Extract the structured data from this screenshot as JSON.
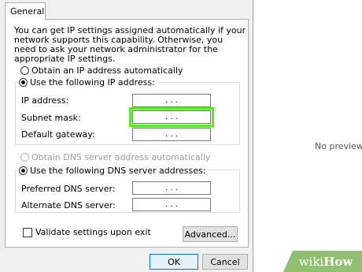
{
  "dialog": {
    "tab_label": "General",
    "intro_text": "You can get IP settings assigned automatically if your network supports this capability. Otherwise, you need to ask your network administrator for the appropriate IP settings.",
    "ip": {
      "auto_label": "Obtain an IP address automatically",
      "manual_label": "Use the following IP address:",
      "fields": [
        {
          "label": "IP address:",
          "value": ".   .   ."
        },
        {
          "label": "Subnet mask:",
          "value": ".   .   ."
        },
        {
          "label": "Default gateway:",
          "value": ".   .   ."
        }
      ]
    },
    "dns": {
      "auto_label": "Obtain DNS server address automatically",
      "manual_label": "Use the following DNS server addresses:",
      "fields": [
        {
          "label": "Preferred DNS server:",
          "value": ".   .   ."
        },
        {
          "label": "Alternate DNS server:",
          "value": ".   .   ."
        }
      ]
    },
    "validate_label": "Validate settings upon exit",
    "advanced_label": "Advanced...",
    "ok_label": "OK",
    "cancel_label": "Cancel"
  },
  "preview": {
    "text": "No preview av"
  },
  "watermark": {
    "wiki": "wiki",
    "how": "How"
  },
  "colors": {
    "highlight": "#4ff214",
    "watermark": "#8fc070"
  }
}
